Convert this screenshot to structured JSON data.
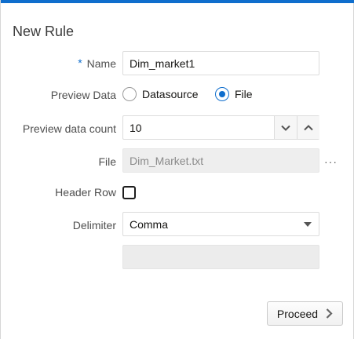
{
  "dialog": {
    "title": "New Rule"
  },
  "form": {
    "name": {
      "required_marker": "*",
      "label": "Name",
      "value": "Dim_market1"
    },
    "preview_data": {
      "label": "Preview Data",
      "options": [
        {
          "label": "Datasource",
          "selected": false
        },
        {
          "label": "File",
          "selected": true
        }
      ]
    },
    "preview_count": {
      "label": "Preview data count",
      "value": "10"
    },
    "file": {
      "label": "File",
      "value": "Dim_Market.txt",
      "more": "···"
    },
    "header_row": {
      "label": "Header Row",
      "checked": false
    },
    "delimiter": {
      "label": "Delimiter",
      "value": "Comma"
    }
  },
  "footer": {
    "proceed_label": "Proceed"
  },
  "colors": {
    "accent": "#0f6ecd",
    "readonly_bg": "#eeeeee"
  },
  "icons": {
    "decrement": "chevron-down-icon",
    "increment": "chevron-up-icon",
    "dropdown": "caret-down-icon",
    "proceed": "chevron-right-icon",
    "browse": "ellipsis-icon"
  }
}
